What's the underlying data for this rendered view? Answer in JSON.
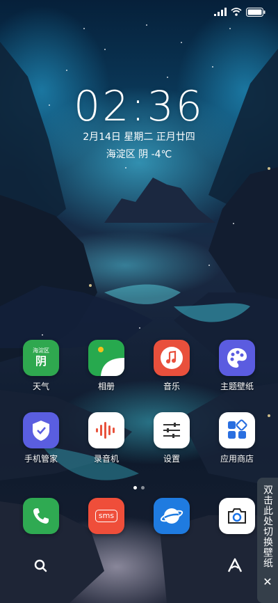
{
  "status": {
    "signal_icon": "signal-icon",
    "wifi_icon": "wifi-icon",
    "battery_icon": "battery-icon"
  },
  "lockscreen": {
    "time": "02:36",
    "date": "2月14日 星期二 正月廿四",
    "weather": "海淀区 阴 -4℃"
  },
  "apps_row1": [
    {
      "label": "天气",
      "icon": "weather-icon",
      "badge_top": "海淀区",
      "badge_main": "阴",
      "color": "#2fa84f"
    },
    {
      "label": "相册",
      "icon": "gallery-icon",
      "color": "#27a94e"
    },
    {
      "label": "音乐",
      "icon": "music-icon",
      "color": "#e9503c"
    },
    {
      "label": "主题壁纸",
      "icon": "theme-icon",
      "color": "#5b5ce0"
    }
  ],
  "apps_row2": [
    {
      "label": "手机管家",
      "icon": "security-icon",
      "color": "#5a5ee0"
    },
    {
      "label": "录音机",
      "icon": "recorder-icon",
      "color": "#ffffff"
    },
    {
      "label": "设置",
      "icon": "settings-icon",
      "color": "#ffffff"
    },
    {
      "label": "应用商店",
      "icon": "app-store-icon",
      "color": "#ffffff"
    }
  ],
  "dock": [
    {
      "icon": "phone-icon",
      "color": "#2faa52"
    },
    {
      "icon": "sms-icon",
      "text": "sms",
      "color": "#ef4e3a"
    },
    {
      "icon": "browser-icon",
      "color": "#1f7be0"
    },
    {
      "icon": "camera-icon",
      "color": "#ffffff"
    }
  ],
  "wallpaper_switch": {
    "label": "双击此处切换壁纸",
    "close_icon": "close-icon"
  },
  "bottom": {
    "search_icon": "search-icon",
    "assistant_icon": "assistant-icon"
  }
}
